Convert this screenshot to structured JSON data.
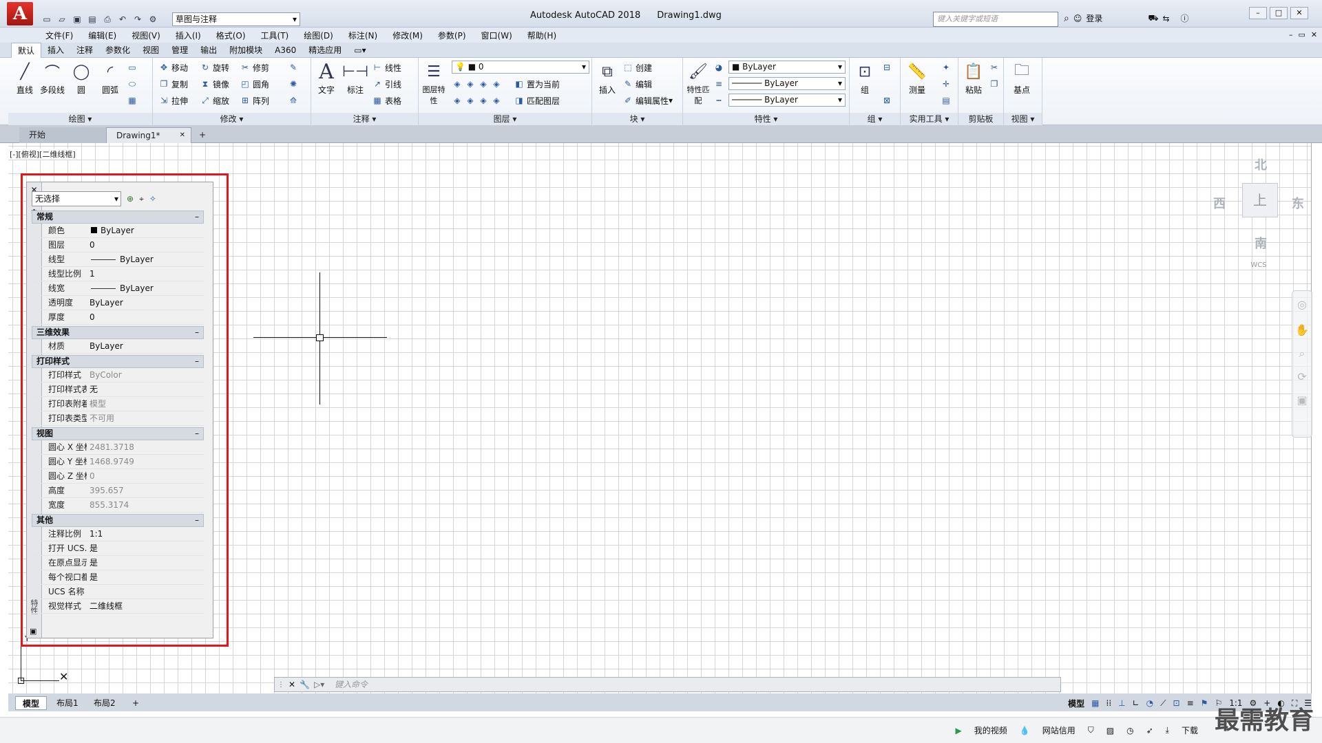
{
  "titlebar": {
    "workspace": "草图与注释",
    "app_title": "Autodesk AutoCAD 2018",
    "file_name": "Drawing1.dwg",
    "search_placeholder": "键入关键字或短语",
    "login": "登录"
  },
  "menu": [
    "文件(F)",
    "编辑(E)",
    "视图(V)",
    "插入(I)",
    "格式(O)",
    "工具(T)",
    "绘图(D)",
    "标注(N)",
    "修改(M)",
    "参数(P)",
    "窗口(W)",
    "帮助(H)"
  ],
  "ribbon_tabs": [
    "默认",
    "插入",
    "注释",
    "参数化",
    "视图",
    "管理",
    "输出",
    "附加模块",
    "A360",
    "精选应用"
  ],
  "ribbon": {
    "draw": {
      "title": "绘图",
      "line": "直线",
      "polyline": "多段线",
      "circle": "圆",
      "arc": "圆弧"
    },
    "modify": {
      "title": "修改",
      "move": "移动",
      "rotate": "旋转",
      "trim": "修剪",
      "copy": "复制",
      "mirror": "镜像",
      "fillet": "圆角",
      "stretch": "拉伸",
      "scale": "缩放",
      "array": "阵列"
    },
    "annotation": {
      "title": "注释",
      "text": "文字",
      "dimension": "标注",
      "linear": "线性",
      "leader": "引线",
      "table": "表格"
    },
    "layers": {
      "title": "图层",
      "layer_props": "图层特性",
      "current": "0",
      "set_current": "置为当前",
      "match_layer": "匹配图层"
    },
    "block": {
      "title": "块",
      "insert": "插入",
      "create": "创建",
      "edit": "编辑",
      "edit_attr": "编辑属性"
    },
    "properties": {
      "title": "特性",
      "match": "特性匹配",
      "color": "ByLayer",
      "linetype": "ByLayer",
      "lineweight": "ByLayer"
    },
    "groups": {
      "title": "组",
      "group": "组"
    },
    "utilities": {
      "title": "实用工具",
      "measure": "测量"
    },
    "clipboard": {
      "title": "剪贴板",
      "paste": "粘贴"
    },
    "view": {
      "title": "视图",
      "base": "基点"
    }
  },
  "doc_tabs": {
    "start": "开始",
    "drawing": "Drawing1*"
  },
  "viewport_label": "[-][俯视][二维线框]",
  "properties_palette": {
    "selection": "无选择",
    "strip_label": "特性",
    "sections": [
      {
        "title": "常规",
        "rows": [
          [
            "颜色",
            "ByLayer"
          ],
          [
            "图层",
            "0"
          ],
          [
            "线型",
            "ByLayer"
          ],
          [
            "线型比例",
            "1"
          ],
          [
            "线宽",
            "ByLayer"
          ],
          [
            "透明度",
            "ByLayer"
          ],
          [
            "厚度",
            "0"
          ]
        ]
      },
      {
        "title": "三维效果",
        "rows": [
          [
            "材质",
            "ByLayer"
          ]
        ]
      },
      {
        "title": "打印样式",
        "rows": [
          [
            "打印样式",
            "ByColor"
          ],
          [
            "打印样式表",
            "无"
          ],
          [
            "打印表附着到",
            "模型"
          ],
          [
            "打印表类型",
            "不可用"
          ]
        ]
      },
      {
        "title": "视图",
        "rows": [
          [
            "圆心 X 坐标",
            "2481.3718"
          ],
          [
            "圆心 Y 坐标",
            "1468.9749"
          ],
          [
            "圆心 Z 坐标",
            "0"
          ],
          [
            "高度",
            "395.657"
          ],
          [
            "宽度",
            "855.3174"
          ]
        ]
      },
      {
        "title": "其他",
        "rows": [
          [
            "注释比例",
            "1:1"
          ],
          [
            "打开 UCS...",
            "是"
          ],
          [
            "在原点显示...",
            "是"
          ],
          [
            "每个视口都...",
            "是"
          ],
          [
            "UCS 名称",
            ""
          ],
          [
            "视觉样式",
            "二维线框"
          ]
        ]
      }
    ]
  },
  "viewcube": {
    "north": "北",
    "south": "南",
    "east": "东",
    "west": "西",
    "top": "上",
    "wcs": "WCS"
  },
  "command_placeholder": "键入命令",
  "layout_tabs": [
    "模型",
    "布局1",
    "布局2"
  ],
  "status": {
    "model": "模型",
    "scale": "1:1"
  },
  "taskbar": {
    "my_video": "我的视频",
    "net_credit": "网站信用",
    "download": "下载"
  },
  "watermark": "最需教育",
  "colors": {
    "accent_red": "#e8141b",
    "autocad_red": "#c4231b",
    "ribbon_bg": "#eef2f7"
  }
}
